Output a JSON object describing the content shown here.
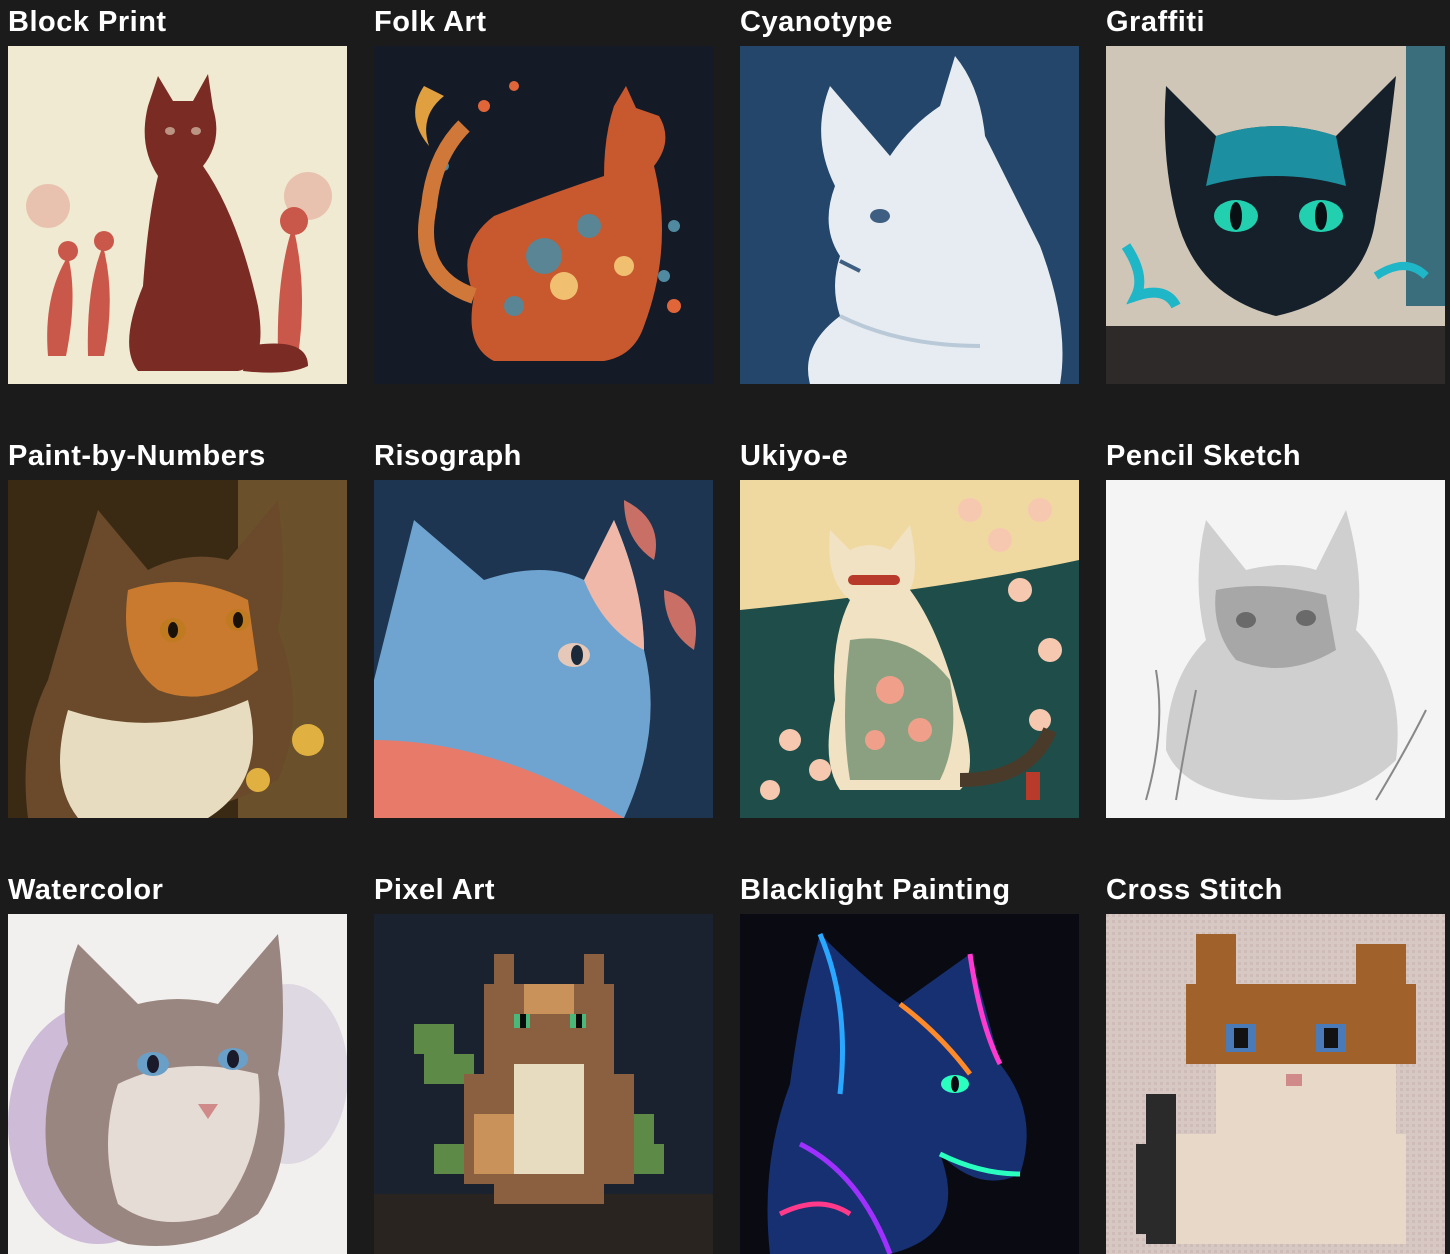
{
  "gallery": {
    "items": [
      {
        "label": "Block Print",
        "icon": "block-print-cat-image",
        "bg": "#f1ead2",
        "fg": "#7a2c24",
        "accent": "#c9584a"
      },
      {
        "label": "Folk Art",
        "icon": "folk-art-cat-image",
        "bg": "#141a26",
        "fg": "#d9663a",
        "accent": "#4f8aa0"
      },
      {
        "label": "Cyanotype",
        "icon": "cyanotype-cat-image",
        "bg": "#24466b",
        "fg": "#e9eef2",
        "accent": "#8fa8c0"
      },
      {
        "label": "Graffiti",
        "icon": "graffiti-cat-image",
        "bg": "#cfc6b8",
        "fg": "#15202a",
        "accent": "#1fb6c8"
      },
      {
        "label": "Paint-by-Numbers",
        "icon": "paint-by-numbers-cat-image",
        "bg": "#3a2a14",
        "fg": "#c97a2e",
        "accent": "#e8dcc0"
      },
      {
        "label": "Risograph",
        "icon": "risograph-cat-image",
        "bg": "#1d3550",
        "fg": "#6fa3d0",
        "accent": "#e87a6a"
      },
      {
        "label": "Ukiyo-e",
        "icon": "ukiyo-e-cat-image",
        "bg": "#1f4e4a",
        "fg": "#f0e2c2",
        "accent": "#f0a08a"
      },
      {
        "label": "Pencil Sketch",
        "icon": "pencil-sketch-cat-image",
        "bg": "#f4f4f4",
        "fg": "#7a7a7a",
        "accent": "#b0b0b0"
      },
      {
        "label": "Watercolor",
        "icon": "watercolor-cat-image",
        "bg": "#f2f0ee",
        "fg": "#7a6a66",
        "accent": "#8a5ab0"
      },
      {
        "label": "Pixel Art",
        "icon": "pixel-art-cat-image",
        "bg": "#1a2230",
        "fg": "#c8925a",
        "accent": "#5e8a48"
      },
      {
        "label": "Blacklight Painting",
        "icon": "blacklight-cat-image",
        "bg": "#0a0a12",
        "fg": "#2aa8ff",
        "accent": "#ff3ad0"
      },
      {
        "label": "Cross Stitch",
        "icon": "cross-stitch-cat-image",
        "bg": "#d8c8c4",
        "fg": "#a0622a",
        "accent": "#2a2a2a"
      }
    ]
  }
}
